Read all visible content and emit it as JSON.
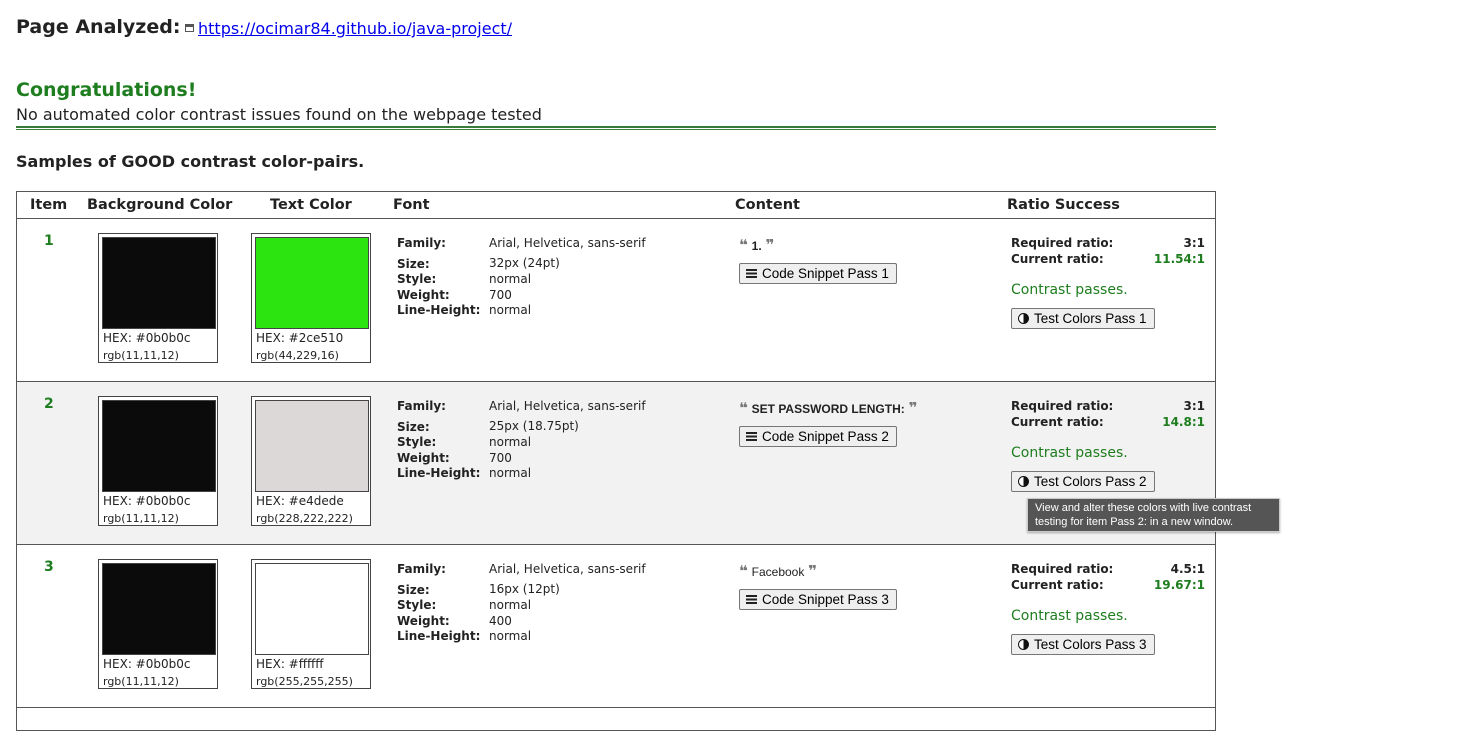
{
  "header": {
    "page_analyzed_label": "Page Analyzed:",
    "url": "https://ocimar84.github.io/java-project/"
  },
  "summary": {
    "title": "Congratulations!",
    "message": "No automated color contrast issues found on the webpage tested"
  },
  "samples_heading": "Samples of GOOD contrast color-pairs.",
  "table": {
    "columns": [
      "Item",
      "Background Color",
      "Text Color",
      "Font",
      "Content",
      "Ratio Success"
    ],
    "font_labels": [
      "Family:",
      "Size:",
      "Style:",
      "Weight:",
      "Line-Height:"
    ],
    "ratio_labels": [
      "Required ratio:",
      "Current ratio:"
    ],
    "rows": [
      {
        "item": "1",
        "bg": {
          "hex": "HEX: #0b0b0c",
          "rgb": "rgb(11,11,12)",
          "color": "#0b0b0c"
        },
        "fg": {
          "hex": "HEX: #2ce510",
          "rgb": "rgb(44,229,16)",
          "color": "#2ce510"
        },
        "font": {
          "family": "Arial, Helvetica, sans-serif",
          "size": "32px (24pt)",
          "style": "normal",
          "weight": "700",
          "line_height": "normal"
        },
        "content": "1.",
        "code_button": "Code Snippet Pass 1",
        "required_ratio": "3:1",
        "current_ratio": "11.54:1",
        "pass_message": "Contrast passes.",
        "test_button": "Test Colors Pass 1"
      },
      {
        "item": "2",
        "bg": {
          "hex": "HEX: #0b0b0c",
          "rgb": "rgb(11,11,12)",
          "color": "#0b0b0c"
        },
        "fg": {
          "hex": "HEX: #e4dede",
          "rgb": "rgb(228,222,222)",
          "color": "#dcd8d8"
        },
        "font": {
          "family": "Arial, Helvetica, sans-serif",
          "size": "25px (18.75pt)",
          "style": "normal",
          "weight": "700",
          "line_height": "normal"
        },
        "content": "SET PASSWORD LENGTH:",
        "code_button": "Code Snippet Pass 2",
        "required_ratio": "3:1",
        "current_ratio": "14.8:1",
        "pass_message": "Contrast passes.",
        "test_button": "Test Colors Pass 2"
      },
      {
        "item": "3",
        "bg": {
          "hex": "HEX: #0b0b0c",
          "rgb": "rgb(11,11,12)",
          "color": "#0b0b0c"
        },
        "fg": {
          "hex": "HEX: #ffffff",
          "rgb": "rgb(255,255,255)",
          "color": "#ffffff"
        },
        "font": {
          "family": "Arial, Helvetica, sans-serif",
          "size": "16px (12pt)",
          "style": "normal",
          "weight": "400",
          "line_height": "normal"
        },
        "content": "Facebook",
        "code_button": "Code Snippet Pass 3",
        "required_ratio": "4.5:1",
        "current_ratio": "19.67:1",
        "pass_message": "Contrast passes.",
        "test_button": "Test Colors Pass 3"
      }
    ]
  },
  "tooltip": {
    "text": "View and alter these colors with live contrast testing for item Pass 2: in a new window."
  },
  "colors": {
    "success_green": "#1e7d1e",
    "link_blue": "#0000ee",
    "row_alt_bg": "#f2f2f2"
  },
  "icons": {
    "link": "new-window-icon",
    "code": "lines-icon",
    "test": "contrast-icon",
    "quote_open": "open-quote-icon",
    "quote_close": "close-quote-icon"
  }
}
